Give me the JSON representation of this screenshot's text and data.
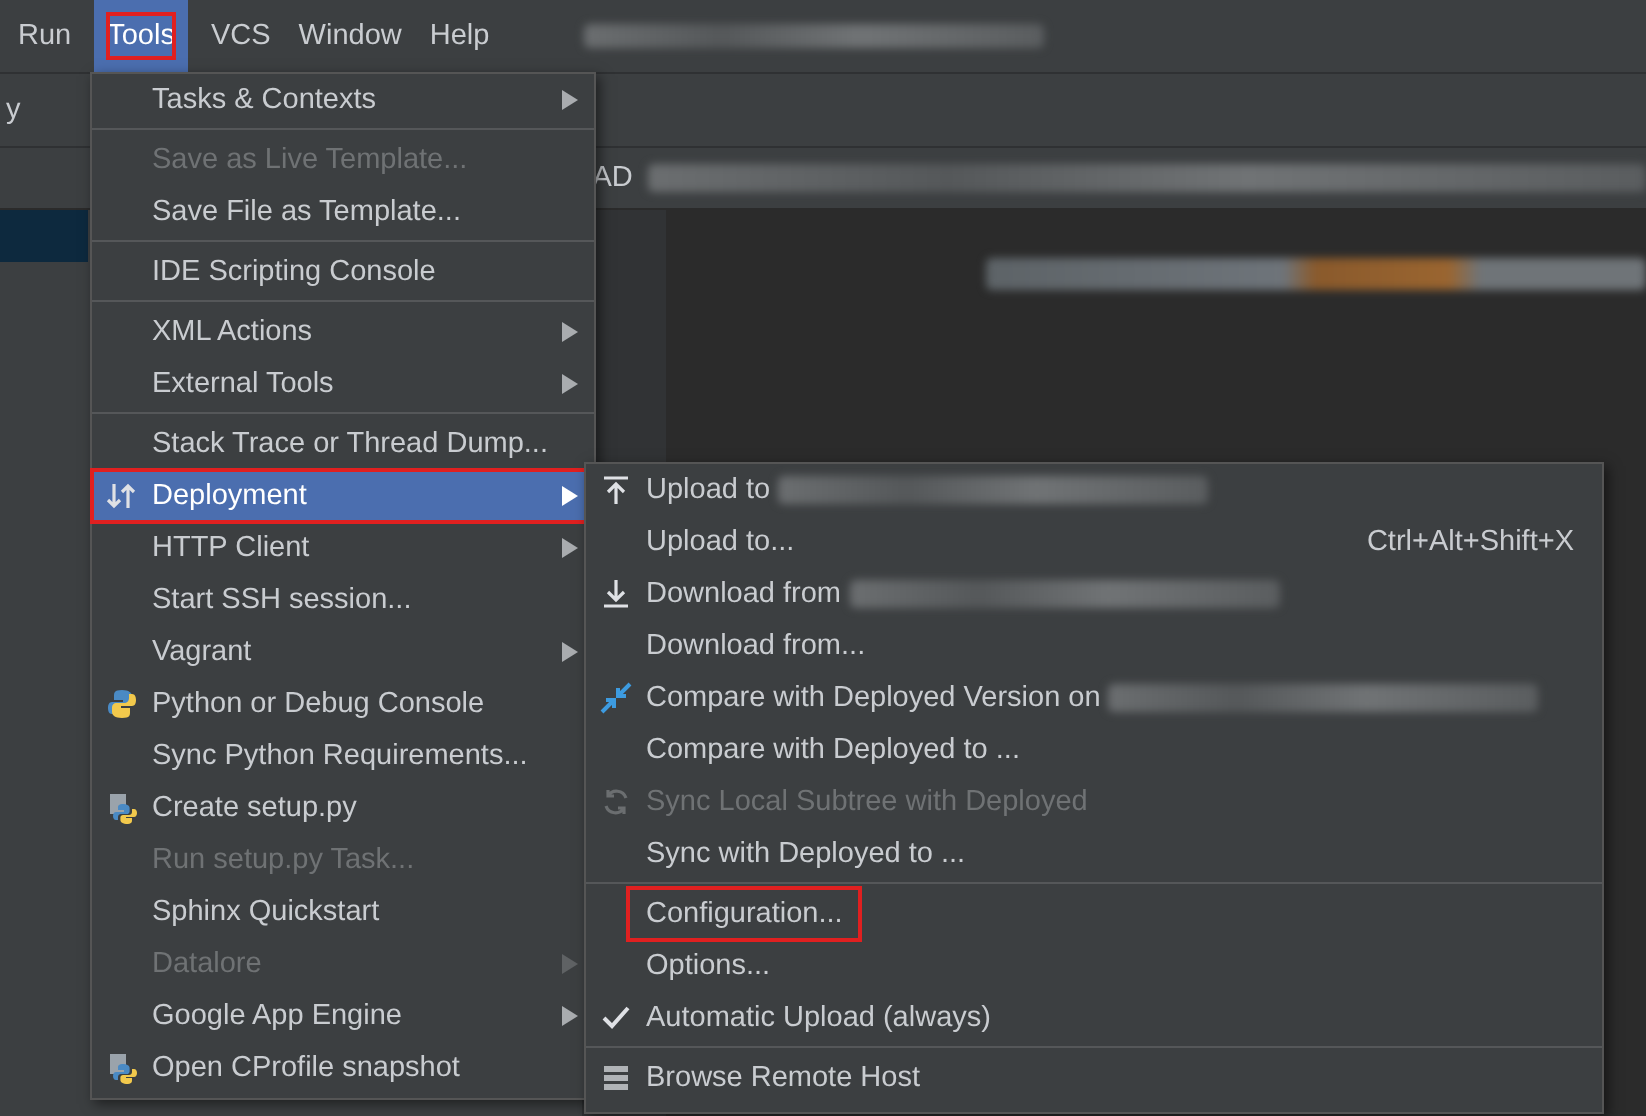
{
  "menu_bar": [
    {
      "label": "Run",
      "selected": false,
      "annotated": false
    },
    {
      "label": "Tools",
      "selected": true,
      "annotated": true
    },
    {
      "label": "VCS",
      "selected": false,
      "annotated": false
    },
    {
      "label": "Window",
      "selected": false,
      "annotated": false
    },
    {
      "label": "Help",
      "selected": false,
      "annotated": false
    }
  ],
  "toolbar": {
    "text": "y"
  },
  "editor_tab": {
    "label": "AD"
  },
  "tools_menu": [
    {
      "kind": "plain",
      "label": "Tasks & Contexts",
      "submenu": true,
      "disabled": false,
      "selected": false,
      "annotated": false
    },
    {
      "kind": "separator"
    },
    {
      "kind": "plain",
      "label": "Save as Live Template...",
      "submenu": false,
      "disabled": true,
      "selected": false,
      "annotated": false
    },
    {
      "kind": "plain",
      "label": "Save File as Template...",
      "submenu": false,
      "disabled": false,
      "selected": false,
      "annotated": false
    },
    {
      "kind": "separator"
    },
    {
      "kind": "plain",
      "label": "IDE Scripting Console",
      "submenu": false,
      "disabled": false,
      "selected": false,
      "annotated": false
    },
    {
      "kind": "separator"
    },
    {
      "kind": "plain",
      "label": "XML Actions",
      "submenu": true,
      "disabled": false,
      "selected": false,
      "annotated": false
    },
    {
      "kind": "plain",
      "label": "External Tools",
      "submenu": true,
      "disabled": false,
      "selected": false,
      "annotated": false
    },
    {
      "kind": "separator"
    },
    {
      "kind": "plain",
      "label": "Stack Trace or Thread Dump...",
      "submenu": false,
      "disabled": false,
      "selected": false,
      "annotated": false
    },
    {
      "kind": "deploy",
      "label": "Deployment",
      "submenu": true,
      "disabled": false,
      "selected": true,
      "annotated": true
    },
    {
      "kind": "plain",
      "label": "HTTP Client",
      "submenu": true,
      "disabled": false,
      "selected": false,
      "annotated": false
    },
    {
      "kind": "plain",
      "label": "Start SSH session...",
      "submenu": false,
      "disabled": false,
      "selected": false,
      "annotated": false
    },
    {
      "kind": "plain",
      "label": "Vagrant",
      "submenu": true,
      "disabled": false,
      "selected": false,
      "annotated": false
    },
    {
      "kind": "python",
      "label": "Python or Debug Console",
      "submenu": false,
      "disabled": false,
      "selected": false,
      "annotated": false
    },
    {
      "kind": "plain",
      "label": "Sync Python Requirements...",
      "submenu": false,
      "disabled": false,
      "selected": false,
      "annotated": false
    },
    {
      "kind": "pyfile",
      "label": "Create setup.py",
      "submenu": false,
      "disabled": false,
      "selected": false,
      "annotated": false
    },
    {
      "kind": "plain",
      "label": "Run setup.py Task...",
      "submenu": false,
      "disabled": true,
      "selected": false,
      "annotated": false
    },
    {
      "kind": "plain",
      "label": "Sphinx Quickstart",
      "submenu": false,
      "disabled": false,
      "selected": false,
      "annotated": false
    },
    {
      "kind": "plain",
      "label": "Datalore",
      "submenu": true,
      "disabled": true,
      "selected": false,
      "annotated": false
    },
    {
      "kind": "plain",
      "label": "Google App Engine",
      "submenu": true,
      "disabled": false,
      "selected": false,
      "annotated": false
    },
    {
      "kind": "pyfile",
      "label": "Open CProfile snapshot",
      "submenu": false,
      "disabled": false,
      "selected": false,
      "annotated": false
    }
  ],
  "deployment_menu": [
    {
      "kind": "upload",
      "label": "Upload to",
      "redacted": true,
      "disabled": false,
      "annotated": false,
      "checked": false
    },
    {
      "kind": "plain",
      "label": "Upload to...",
      "shortcut": "Ctrl+Alt+Shift+X",
      "redacted": false,
      "disabled": false,
      "annotated": false,
      "checked": false
    },
    {
      "kind": "download",
      "label": "Download from",
      "redacted": true,
      "disabled": false,
      "annotated": false,
      "checked": false
    },
    {
      "kind": "plain",
      "label": "Download from...",
      "redacted": false,
      "disabled": false,
      "annotated": false,
      "checked": false
    },
    {
      "kind": "compare",
      "label": "Compare with Deployed Version on",
      "redacted": true,
      "disabled": false,
      "annotated": false,
      "checked": false
    },
    {
      "kind": "plain",
      "label": "Compare with Deployed to ...",
      "redacted": false,
      "disabled": false,
      "annotated": false,
      "checked": false
    },
    {
      "kind": "sync",
      "label": "Sync Local Subtree with Deployed",
      "redacted": false,
      "disabled": true,
      "annotated": false,
      "checked": false
    },
    {
      "kind": "plain",
      "label": "Sync with Deployed to ...",
      "redacted": false,
      "disabled": false,
      "annotated": false,
      "checked": false
    },
    {
      "kind": "separator"
    },
    {
      "kind": "plain",
      "label": "Configuration...",
      "redacted": false,
      "disabled": false,
      "annotated": true,
      "checked": false
    },
    {
      "kind": "plain",
      "label": "Options...",
      "redacted": false,
      "disabled": false,
      "annotated": false,
      "checked": false
    },
    {
      "kind": "plain",
      "label": "Automatic Upload (always)",
      "redacted": false,
      "disabled": false,
      "annotated": false,
      "checked": true
    },
    {
      "kind": "separator"
    },
    {
      "kind": "server",
      "label": "Browse Remote Host",
      "redacted": false,
      "disabled": false,
      "annotated": false,
      "checked": false
    }
  ]
}
